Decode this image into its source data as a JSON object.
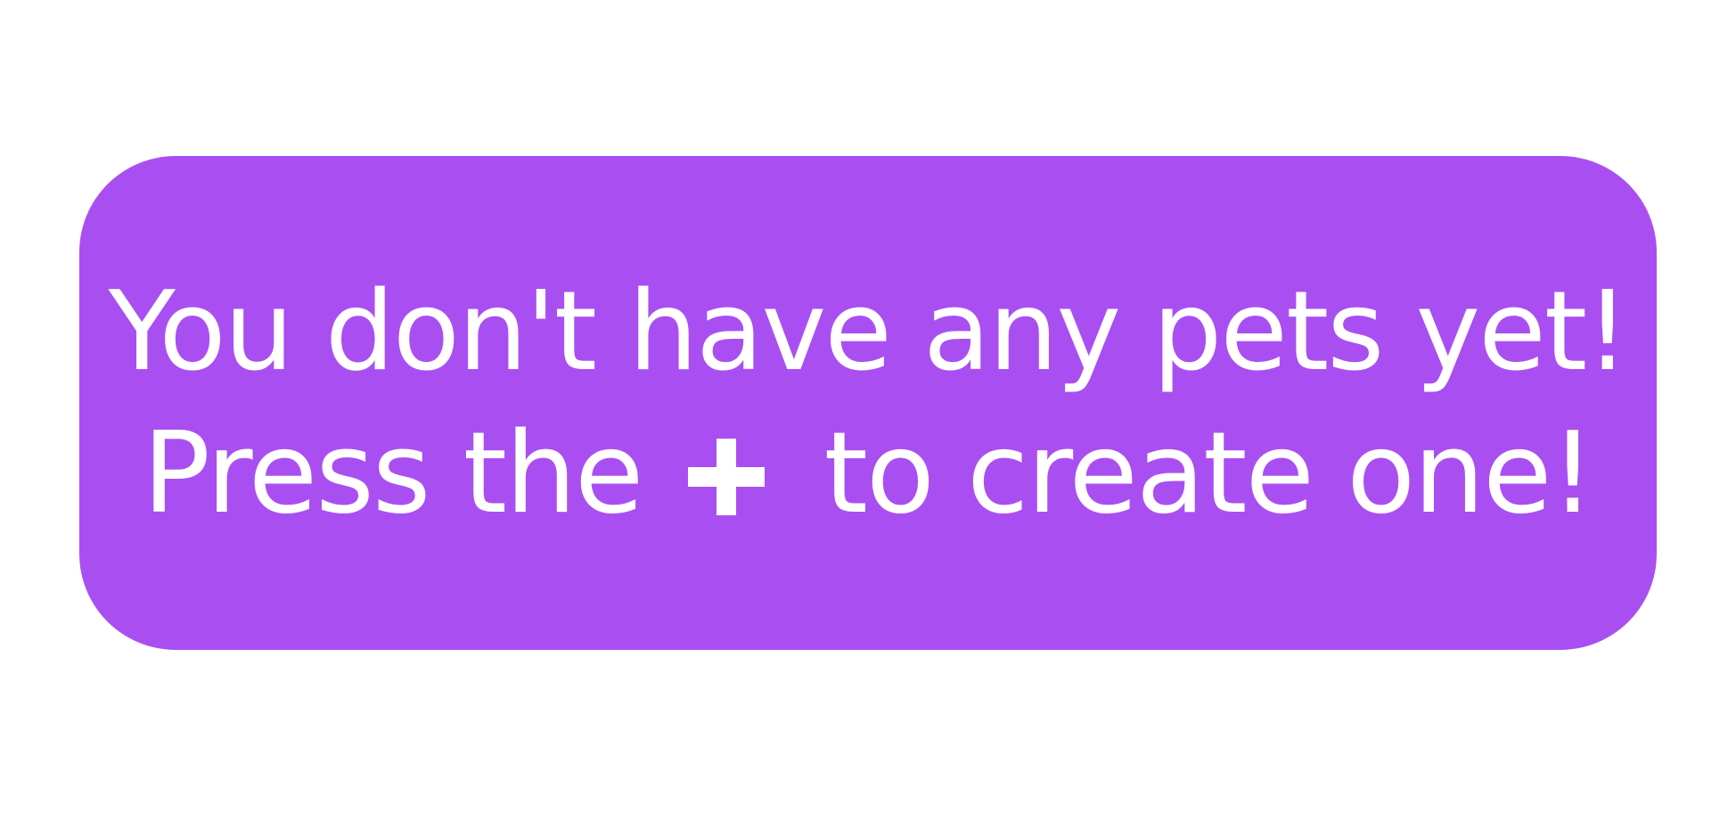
{
  "empty_state": {
    "line1": "You don't have any pets yet!",
    "line2_before": "Press the",
    "line2_after": "to create one!",
    "icon": "plus-icon",
    "colors": {
      "card_background": "#a94ff2",
      "text": "#ffffff",
      "page_background": "#ffffff"
    }
  }
}
